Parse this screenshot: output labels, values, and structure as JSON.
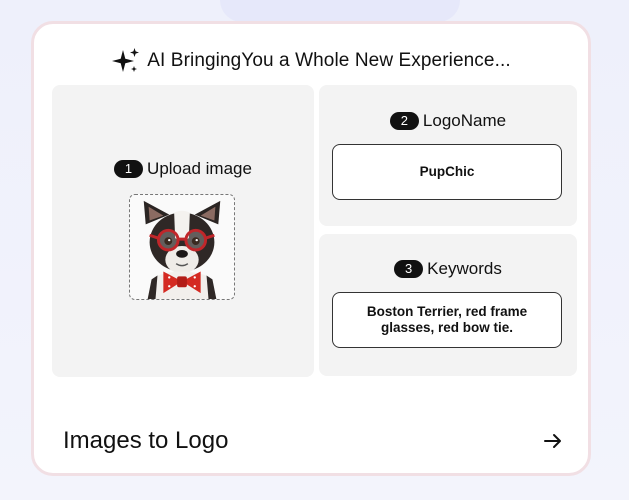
{
  "header": {
    "text": "AI BringingYou a Whole New Experience...",
    "icon": "sparkle-icon"
  },
  "upload": {
    "step": "1",
    "label": "Upload image",
    "image_alt": "Boston Terrier with red glasses and red bow tie"
  },
  "logo_name": {
    "step": "2",
    "label": "LogoName",
    "value": "PupChic"
  },
  "keywords": {
    "step": "3",
    "label": "Keywords",
    "value": "Boston Terrier, red frame glasses, red bow tie."
  },
  "footer": {
    "title": "Images to Logo",
    "action_icon": "arrow-right-icon"
  },
  "colors": {
    "accent": "#111111",
    "card_border": "#f1dfe4",
    "panel_bg": "#f3f3f3",
    "page_bg": "#eef0fb"
  }
}
